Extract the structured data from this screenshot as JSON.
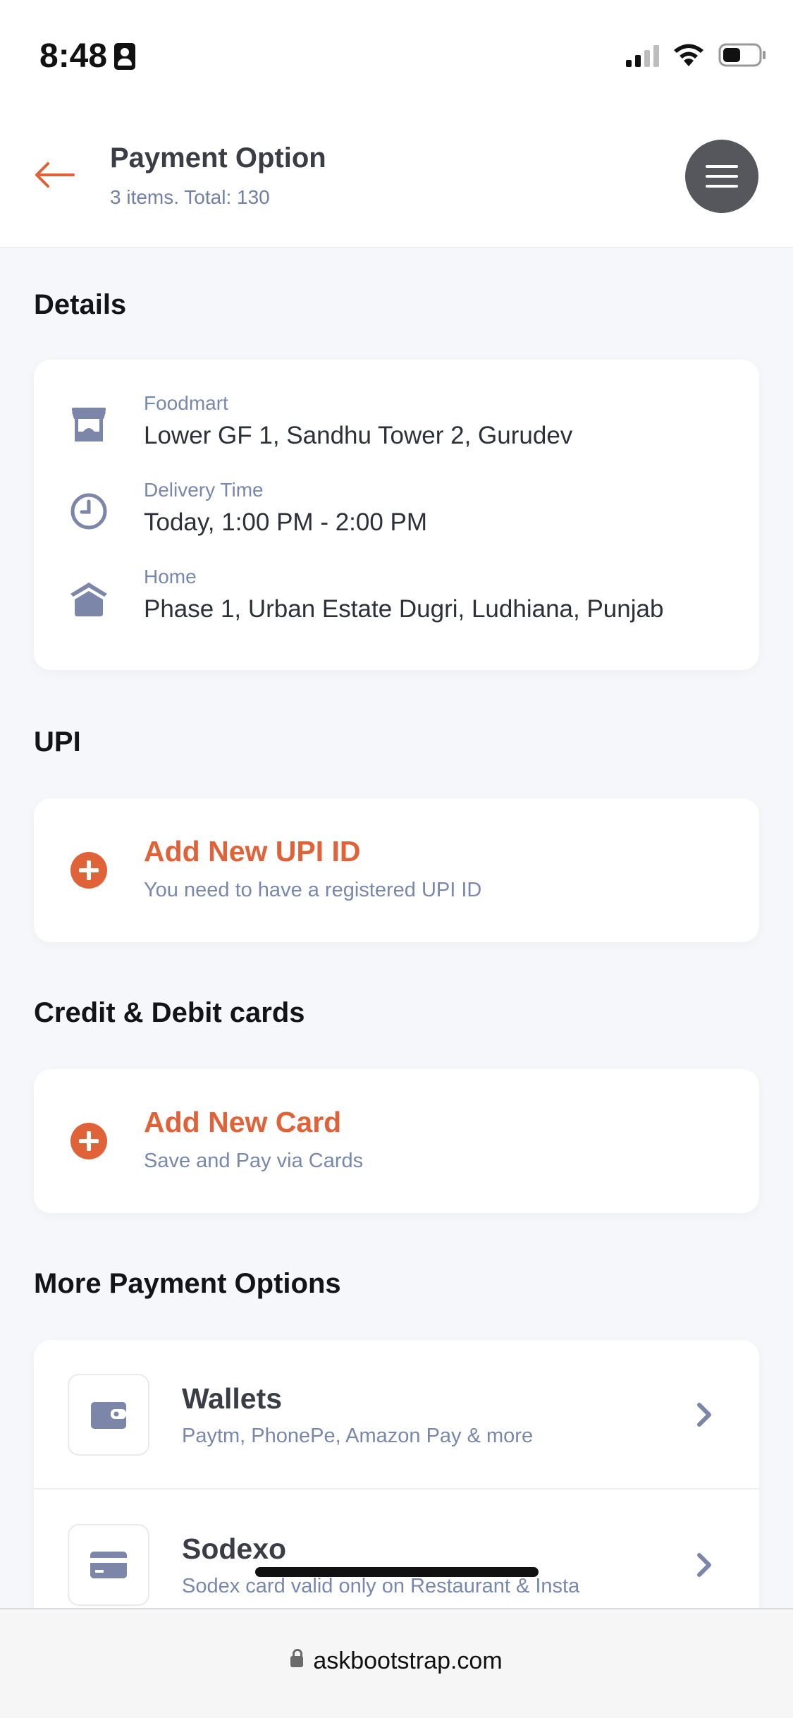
{
  "status_bar": {
    "time": "8:48"
  },
  "header": {
    "title": "Payment Option",
    "subtitle": "3 items. Total: 130"
  },
  "details": {
    "section_title": "Details",
    "rows": [
      {
        "icon": "store-icon",
        "label": "Foodmart",
        "value": "Lower GF 1, Sandhu Tower 2, Gurudev"
      },
      {
        "icon": "clock-icon",
        "label": "Delivery Time",
        "value": "Today, 1:00 PM - 2:00 PM"
      },
      {
        "icon": "home-icon",
        "label": "Home",
        "value": "Phase 1, Urban Estate Dugri, Ludhiana, Punjab"
      }
    ]
  },
  "upi": {
    "section_title": "UPI",
    "add_title": "Add New UPI ID",
    "add_sub": "You need to have a registered UPI ID"
  },
  "cards": {
    "section_title": "Credit & Debit cards",
    "add_title": "Add New Card",
    "add_sub": "Save and Pay via Cards"
  },
  "more": {
    "section_title": "More Payment Options",
    "options": [
      {
        "icon": "wallet-icon",
        "title": "Wallets",
        "sub": "Paytm, PhonePe, Amazon Pay & more"
      },
      {
        "icon": "card-icon",
        "title": "Sodexo",
        "sub": "Sodex card valid only on Restaurant & Insta"
      }
    ]
  },
  "browser": {
    "url": "askbootstrap.com"
  },
  "colors": {
    "accent": "#e06238",
    "muted": "#7888ad",
    "icon": "#7b86a8"
  }
}
